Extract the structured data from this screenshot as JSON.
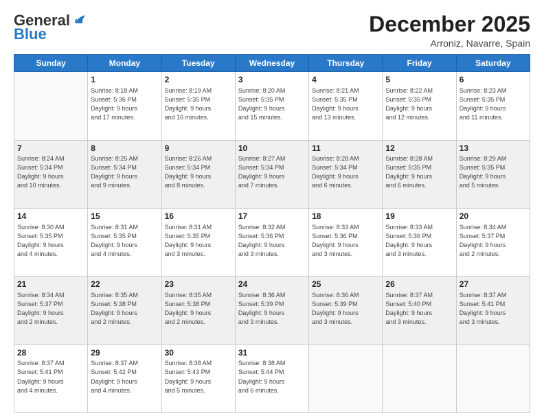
{
  "header": {
    "logo_general": "General",
    "logo_blue": "Blue",
    "month_title": "December 2025",
    "subtitle": "Arroniz, Navarre, Spain"
  },
  "weekdays": [
    "Sunday",
    "Monday",
    "Tuesday",
    "Wednesday",
    "Thursday",
    "Friday",
    "Saturday"
  ],
  "weeks": [
    [
      {
        "day": "",
        "info": ""
      },
      {
        "day": "1",
        "info": "Sunrise: 8:18 AM\nSunset: 5:36 PM\nDaylight: 9 hours\nand 17 minutes."
      },
      {
        "day": "2",
        "info": "Sunrise: 8:19 AM\nSunset: 5:35 PM\nDaylight: 9 hours\nand 16 minutes."
      },
      {
        "day": "3",
        "info": "Sunrise: 8:20 AM\nSunset: 5:35 PM\nDaylight: 9 hours\nand 15 minutes."
      },
      {
        "day": "4",
        "info": "Sunrise: 8:21 AM\nSunset: 5:35 PM\nDaylight: 9 hours\nand 13 minutes."
      },
      {
        "day": "5",
        "info": "Sunrise: 8:22 AM\nSunset: 5:35 PM\nDaylight: 9 hours\nand 12 minutes."
      },
      {
        "day": "6",
        "info": "Sunrise: 8:23 AM\nSunset: 5:35 PM\nDaylight: 9 hours\nand 11 minutes."
      }
    ],
    [
      {
        "day": "7",
        "info": "Sunrise: 8:24 AM\nSunset: 5:34 PM\nDaylight: 9 hours\nand 10 minutes."
      },
      {
        "day": "8",
        "info": "Sunrise: 8:25 AM\nSunset: 5:34 PM\nDaylight: 9 hours\nand 9 minutes."
      },
      {
        "day": "9",
        "info": "Sunrise: 8:26 AM\nSunset: 5:34 PM\nDaylight: 9 hours\nand 8 minutes."
      },
      {
        "day": "10",
        "info": "Sunrise: 8:27 AM\nSunset: 5:34 PM\nDaylight: 9 hours\nand 7 minutes."
      },
      {
        "day": "11",
        "info": "Sunrise: 8:28 AM\nSunset: 5:34 PM\nDaylight: 9 hours\nand 6 minutes."
      },
      {
        "day": "12",
        "info": "Sunrise: 8:28 AM\nSunset: 5:35 PM\nDaylight: 9 hours\nand 6 minutes."
      },
      {
        "day": "13",
        "info": "Sunrise: 8:29 AM\nSunset: 5:35 PM\nDaylight: 9 hours\nand 5 minutes."
      }
    ],
    [
      {
        "day": "14",
        "info": "Sunrise: 8:30 AM\nSunset: 5:35 PM\nDaylight: 9 hours\nand 4 minutes."
      },
      {
        "day": "15",
        "info": "Sunrise: 8:31 AM\nSunset: 5:35 PM\nDaylight: 9 hours\nand 4 minutes."
      },
      {
        "day": "16",
        "info": "Sunrise: 8:31 AM\nSunset: 5:35 PM\nDaylight: 9 hours\nand 3 minutes."
      },
      {
        "day": "17",
        "info": "Sunrise: 8:32 AM\nSunset: 5:36 PM\nDaylight: 9 hours\nand 3 minutes."
      },
      {
        "day": "18",
        "info": "Sunrise: 8:33 AM\nSunset: 5:36 PM\nDaylight: 9 hours\nand 3 minutes."
      },
      {
        "day": "19",
        "info": "Sunrise: 8:33 AM\nSunset: 5:36 PM\nDaylight: 9 hours\nand 3 minutes."
      },
      {
        "day": "20",
        "info": "Sunrise: 8:34 AM\nSunset: 5:37 PM\nDaylight: 9 hours\nand 2 minutes."
      }
    ],
    [
      {
        "day": "21",
        "info": "Sunrise: 8:34 AM\nSunset: 5:37 PM\nDaylight: 9 hours\nand 2 minutes."
      },
      {
        "day": "22",
        "info": "Sunrise: 8:35 AM\nSunset: 5:38 PM\nDaylight: 9 hours\nand 2 minutes."
      },
      {
        "day": "23",
        "info": "Sunrise: 8:35 AM\nSunset: 5:38 PM\nDaylight: 9 hours\nand 2 minutes."
      },
      {
        "day": "24",
        "info": "Sunrise: 8:36 AM\nSunset: 5:39 PM\nDaylight: 9 hours\nand 3 minutes."
      },
      {
        "day": "25",
        "info": "Sunrise: 8:36 AM\nSunset: 5:39 PM\nDaylight: 9 hours\nand 3 minutes."
      },
      {
        "day": "26",
        "info": "Sunrise: 8:37 AM\nSunset: 5:40 PM\nDaylight: 9 hours\nand 3 minutes."
      },
      {
        "day": "27",
        "info": "Sunrise: 8:37 AM\nSunset: 5:41 PM\nDaylight: 9 hours\nand 3 minutes."
      }
    ],
    [
      {
        "day": "28",
        "info": "Sunrise: 8:37 AM\nSunset: 5:41 PM\nDaylight: 9 hours\nand 4 minutes."
      },
      {
        "day": "29",
        "info": "Sunrise: 8:37 AM\nSunset: 5:42 PM\nDaylight: 9 hours\nand 4 minutes."
      },
      {
        "day": "30",
        "info": "Sunrise: 8:38 AM\nSunset: 5:43 PM\nDaylight: 9 hours\nand 5 minutes."
      },
      {
        "day": "31",
        "info": "Sunrise: 8:38 AM\nSunset: 5:44 PM\nDaylight: 9 hours\nand 6 minutes."
      },
      {
        "day": "",
        "info": ""
      },
      {
        "day": "",
        "info": ""
      },
      {
        "day": "",
        "info": ""
      }
    ]
  ]
}
